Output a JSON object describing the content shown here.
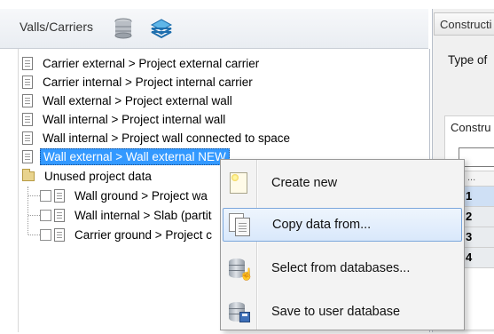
{
  "left_panel": {
    "title": "Valls/Carriers",
    "header_icons": [
      "database-icon",
      "layers-icon"
    ]
  },
  "tree": {
    "items": [
      {
        "label": "Carrier external > Project external carrier"
      },
      {
        "label": "Carrier internal > Project internal carrier"
      },
      {
        "label": "Wall external > Project external wall"
      },
      {
        "label": "Wall internal > Project internal wall"
      },
      {
        "label": "Wall internal > Project wall connected to space"
      },
      {
        "label": "Wall external > Wall external NEW",
        "selected": true
      }
    ],
    "unused_group": {
      "label": "Unused project data",
      "children": [
        {
          "label": "Wall ground > Project wa"
        },
        {
          "label": "Wall internal > Slab (partit"
        },
        {
          "label": "Carrier ground > Project c"
        }
      ]
    }
  },
  "right_panel": {
    "tab_label": "Constructi",
    "type_label": "Type of",
    "group_label": "Constru",
    "grid_header": "...",
    "grid_rows": [
      "1",
      "2",
      "3",
      "4"
    ]
  },
  "context_menu": {
    "items": [
      {
        "label": "Create new",
        "icon": "new-document-icon"
      },
      {
        "label": "Copy data from...",
        "icon": "copy-icon",
        "highlighted": true
      },
      {
        "label": "Select from databases...",
        "icon": "database-select-icon"
      },
      {
        "label": "Save to user database",
        "icon": "database-save-icon"
      }
    ]
  },
  "colors": {
    "selection": "#3399ff",
    "menu_highlight_border": "#7ba7dc",
    "menu_background": "#f3f3f3"
  }
}
